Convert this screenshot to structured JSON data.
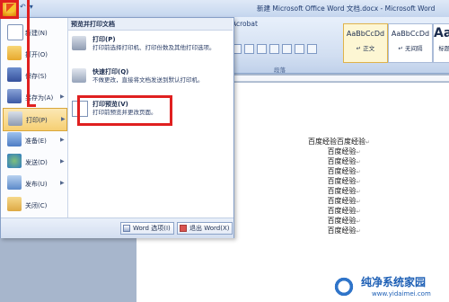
{
  "window": {
    "title": "新建 Microsoft Office Word 文档.docx - Microsoft Word"
  },
  "ribbon": {
    "tab_visible": "Acrobat",
    "group_label": "段落",
    "styles": [
      {
        "sample": "AaBbCcDd",
        "name": "↵ 正文",
        "active": true
      },
      {
        "sample": "AaBbCcDd",
        "name": "↵ 无间隔",
        "active": false
      },
      {
        "sample": "AaBb",
        "name": "标题 1",
        "active": false
      }
    ]
  },
  "office_menu": {
    "items": [
      {
        "label": "新建(N)",
        "icon": "new-document-icon"
      },
      {
        "label": "打开(O)",
        "icon": "open-folder-icon"
      },
      {
        "label": "保存(S)",
        "icon": "save-icon"
      },
      {
        "label": "另存为(A)",
        "icon": "save-as-icon",
        "has_submenu": true
      },
      {
        "label": "打印(P)",
        "icon": "printer-icon",
        "has_submenu": true,
        "selected": true
      },
      {
        "label": "准备(E)",
        "icon": "prepare-icon",
        "has_submenu": true
      },
      {
        "label": "发送(D)",
        "icon": "send-icon",
        "has_submenu": true
      },
      {
        "label": "发布(U)",
        "icon": "publish-icon",
        "has_submenu": true
      },
      {
        "label": "关闭(C)",
        "icon": "close-folder-icon"
      }
    ],
    "submenu": {
      "header": "预览并打印文档",
      "items": [
        {
          "title": "打印(P)",
          "desc": "打印前选择打印机、打印份数及其他打印选项。",
          "icon": "printer-icon"
        },
        {
          "title": "快速打印(Q)",
          "desc": "不做更改，直接将文档发送到默认打印机。",
          "icon": "quick-print-icon"
        },
        {
          "title": "打印预览(V)",
          "desc": "打印前预览并更改页面。",
          "icon": "print-preview-icon"
        }
      ]
    },
    "bottom": {
      "options_label": "Word 选项(I)",
      "exit_label": "退出 Word(X)"
    }
  },
  "document": {
    "lines": [
      "百度经验百度经验",
      "百度经验",
      "百度经验",
      "百度经验",
      "百度经验",
      "百度经验",
      "百度经验",
      "百度经验",
      "百度经验",
      "百度经验"
    ],
    "para_mark": "↵"
  },
  "watermark": {
    "main": "纯净系统家园",
    "url": "www.yidaimei.com"
  },
  "colors": {
    "highlight": "#e02020",
    "ribbon": "#d1def1",
    "selected_item": "#f6cf73"
  }
}
